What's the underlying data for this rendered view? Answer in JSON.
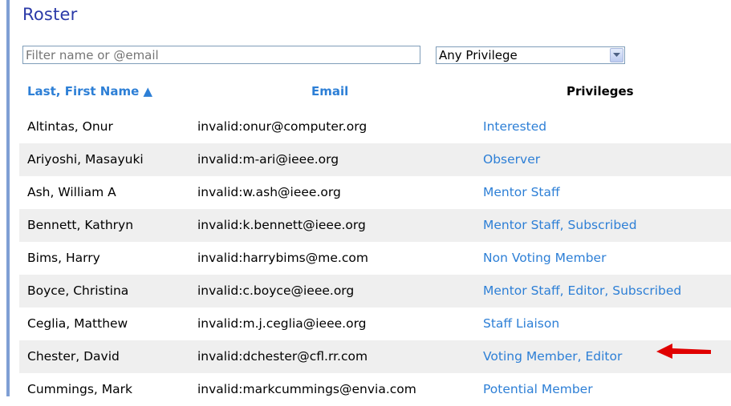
{
  "page": {
    "title": "Roster"
  },
  "filter": {
    "placeholder": "Filter name or @email",
    "value": ""
  },
  "privilege_filter": {
    "selected": "Any Privilege"
  },
  "table": {
    "columns": {
      "name": "Last, First Name ▲",
      "email": "Email",
      "privileges": "Privileges"
    },
    "rows": [
      {
        "name": "Altintas, Onur",
        "email": "invalid:onur@computer.org",
        "privileges": "Interested"
      },
      {
        "name": "Ariyoshi, Masayuki",
        "email": "invalid:m-ari@ieee.org",
        "privileges": "Observer"
      },
      {
        "name": "Ash, William A",
        "email": "invalid:w.ash@ieee.org",
        "privileges": "Mentor Staff"
      },
      {
        "name": "Bennett, Kathryn",
        "email": "invalid:k.bennett@ieee.org",
        "privileges": "Mentor Staff, Subscribed"
      },
      {
        "name": "Bims, Harry",
        "email": "invalid:harrybims@me.com",
        "privileges": "Non Voting Member"
      },
      {
        "name": "Boyce, Christina",
        "email": "invalid:c.boyce@ieee.org",
        "privileges": "Mentor Staff, Editor, Subscribed"
      },
      {
        "name": "Ceglia, Matthew",
        "email": "invalid:m.j.ceglia@ieee.org",
        "privileges": "Staff Liaison"
      },
      {
        "name": "Chester, David",
        "email": "invalid:dchester@cfl.rr.com",
        "privileges": "Voting Member, Editor"
      },
      {
        "name": "Cummings, Mark",
        "email": "invalid:markcummings@envia.com",
        "privileges": "Potential Member"
      }
    ]
  },
  "colors": {
    "title": "#2b3aa8",
    "link": "#2d7fd6",
    "row_alt": "#efefef",
    "annotation_arrow": "#e00000"
  },
  "icons": {
    "sort": "sort-ascending-icon",
    "dropdown": "chevron-down-icon",
    "annotation": "red-arrow-icon"
  }
}
